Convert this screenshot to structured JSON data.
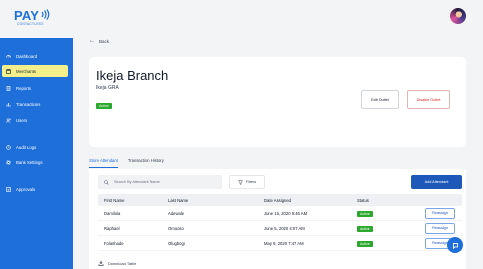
{
  "brand": {
    "logo_main": "PAY",
    "logo_sub": "CONTACTLESS"
  },
  "sidebar": {
    "items": [
      {
        "label": "Dashboard",
        "icon": "dashboard-icon"
      },
      {
        "label": "Merchants",
        "icon": "store-icon",
        "active": true
      },
      {
        "label": "Reports",
        "icon": "reports-icon"
      },
      {
        "label": "Transactions",
        "icon": "transactions-icon"
      },
      {
        "label": "Users",
        "icon": "users-icon"
      },
      {
        "label": "Audit Logs",
        "icon": "audit-icon"
      },
      {
        "label": "Bank Settings",
        "icon": "gear-icon"
      },
      {
        "label": "Approvals",
        "icon": "approvals-icon"
      }
    ]
  },
  "back_label": "Back",
  "branch": {
    "title": "Ikeja Branch",
    "subtitle": "Ikeja GRA",
    "status": "Active",
    "edit_label": "Edit Outlet",
    "disable_label": "Disable Outlet"
  },
  "tabs": [
    {
      "label": "Store Attendant",
      "active": true
    },
    {
      "label": "Transaction History",
      "active": false
    }
  ],
  "search": {
    "placeholder": "Search By Attendant Name"
  },
  "filters_label": "Filters",
  "add_label": "Add Attendant",
  "table": {
    "headers": [
      "First Name",
      "Last Name",
      "Date Assigned",
      "Status",
      ""
    ],
    "rows": [
      {
        "first": "Damilola",
        "last": "Adewale",
        "date": "June 15, 2020 9:46 AM",
        "status": "Active",
        "action": "Reassign"
      },
      {
        "first": "Raphael",
        "last": "Omuoso",
        "date": "June 5, 2020 4:07 AM",
        "status": "Active",
        "action": "Reassign"
      },
      {
        "first": "Folashade",
        "last": "Olugbogi",
        "date": "May 9, 2020 7:47 AM",
        "status": "Active",
        "action": "Reassign"
      }
    ]
  },
  "download_label": "Download Table",
  "colors": {
    "primary": "#1e6fd9",
    "active_nav": "#f3ef8a",
    "success": "#2ba82e",
    "danger": "#d62828"
  }
}
